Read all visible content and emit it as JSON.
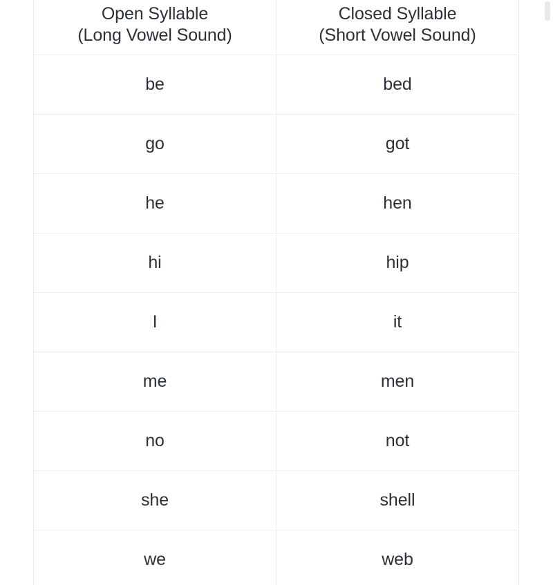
{
  "table": {
    "headers": [
      {
        "line1": "Open Syllable",
        "line2": "(Long Vowel Sound)"
      },
      {
        "line1": "Closed Syllable",
        "line2": "(Short Vowel Sound)"
      }
    ],
    "rows": [
      {
        "open": "be",
        "closed": "bed"
      },
      {
        "open": "go",
        "closed": "got"
      },
      {
        "open": "he",
        "closed": "hen"
      },
      {
        "open": "hi",
        "closed": "hip"
      },
      {
        "open": "I",
        "closed": "it"
      },
      {
        "open": "me",
        "closed": "men"
      },
      {
        "open": "no",
        "closed": "not"
      },
      {
        "open": "she",
        "closed": "shell"
      },
      {
        "open": "we",
        "closed": "web"
      }
    ]
  },
  "scrollbar": {
    "orientation": "vertical",
    "thumb_color": "#e6e8ea"
  },
  "colors": {
    "text": "#2c3038",
    "border": "#eceef0",
    "background": "#ffffff"
  }
}
